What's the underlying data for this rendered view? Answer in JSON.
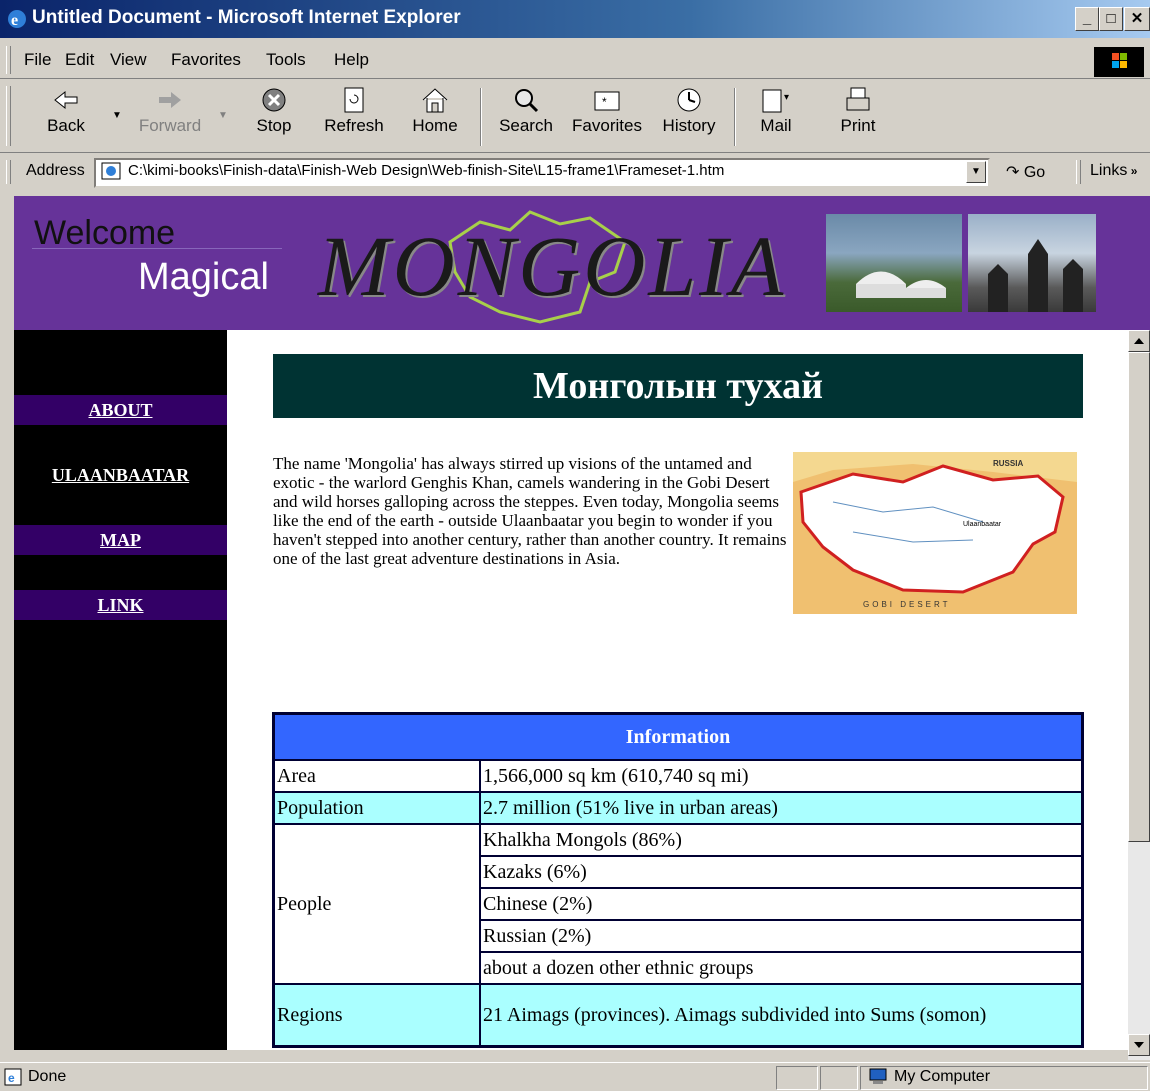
{
  "window": {
    "title": "Untitled Document - Microsoft Internet Explorer",
    "min": "_",
    "max": "□",
    "close": "✕"
  },
  "menu": {
    "file": "File",
    "edit": "Edit",
    "view": "View",
    "favorites": "Favorites",
    "tools": "Tools",
    "help": "Help"
  },
  "toolbar": {
    "back": "Back",
    "forward": "Forward",
    "stop": "Stop",
    "refresh": "Refresh",
    "home": "Home",
    "search": "Search",
    "favorites": "Favorites",
    "history": "History",
    "mail": "Mail",
    "print": "Print"
  },
  "address": {
    "label": "Address",
    "url": "C:\\kimi-books\\Finish-data\\Finish-Web Design\\Web-finish-Site\\L15-frame1\\Frameset-1.htm",
    "go": "Go",
    "links": "Links"
  },
  "banner": {
    "welcome": "Welcome",
    "magical": "Magical",
    "logo_text": "MONGOLIA"
  },
  "nav": {
    "about": "ABOUT",
    "ulaanbaatar": "ULAANBAATAR",
    "map": "MAP",
    "link": "LINK"
  },
  "page": {
    "heading": "Монголын тухай",
    "intro": "The name 'Mongolia' has always stirred up visions of the untamed and exotic - the warlord Genghis Khan, camels wandering in the Gobi Desert and wild horses galloping across the steppes. Even today, Mongolia seems like the end of the earth - outside Ulaanbaatar you begin to wonder if you haven't stepped into another century, rather than another country. It remains one of the last great adventure destinations in Asia.",
    "map_labels": {
      "russia": "RUSSIA",
      "gobi": "GOBI DESERT",
      "ulaanbaatar": "Ulaanbaatar"
    },
    "table": {
      "header": "Information",
      "area_label": "Area",
      "area_value": "1,566,000 sq km (610,740 sq mi)",
      "population_label": "Population",
      "population_value": "2.7 million (51% live in urban areas)",
      "people_label": "People",
      "people": [
        "Khalkha Mongols (86%)",
        "Kazaks (6%)",
        "Chinese (2%)",
        "Russian (2%)",
        "about a dozen other ethnic groups"
      ],
      "regions_label": "Regions",
      "regions_value": "21 Aimags (provinces). Aimags subdivided into Sums (somon)"
    }
  },
  "status": {
    "done": "Done",
    "zone": "My Computer"
  },
  "colors": {
    "banner": "#663399",
    "nav_button": "#330066",
    "heading_bg": "#003333",
    "table_header": "#3366ff",
    "row_cyan": "#aaffff"
  }
}
